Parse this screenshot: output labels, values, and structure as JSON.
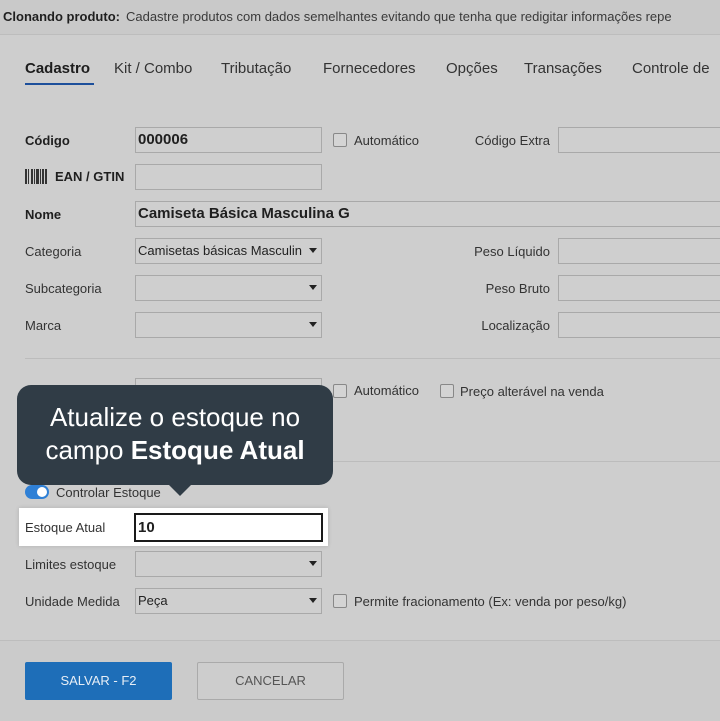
{
  "banner": {
    "title": "Clonando produto:",
    "message": "Cadastre produtos com dados semelhantes evitando que tenha que redigitar informações repe"
  },
  "tabs": [
    "Cadastro",
    "Kit / Combo",
    "Tributação",
    "Fornecedores",
    "Opções",
    "Transações",
    "Controle de"
  ],
  "form": {
    "codigo_label": "Código",
    "codigo_value": "000006",
    "automatico_label": "Automático",
    "codigo_extra_label": "Código Extra",
    "codigo_extra_value": "",
    "ean_label": "EAN / GTIN",
    "ean_value": "",
    "nome_label": "Nome",
    "nome_value": "Camiseta Básica Masculina G",
    "categoria_label": "Categoria",
    "categoria_value": "Camisetas básicas Masculin",
    "peso_liquido_label": "Peso Líquido",
    "subcategoria_label": "Subcategoria",
    "subcategoria_value": "",
    "peso_bruto_label": "Peso Bruto",
    "marca_label": "Marca",
    "marca_value": "",
    "localizacao_label": "Localização",
    "automatico2_label": "Automático",
    "preco_alteravel_label": "Preço alterável na venda",
    "controlar_estoque_label": "Controlar Estoque",
    "controlar_estoque_on": true,
    "estoque_atual_label": "Estoque Atual",
    "estoque_atual_value": "10",
    "limites_label": "Limites estoque",
    "limites_value": "",
    "unidade_label": "Unidade Medida",
    "unidade_value": "Peça",
    "fracionamento_label": "Permite fracionamento (Ex: venda por peso/kg)"
  },
  "tooltip": {
    "line1": "Atualize o estoque no",
    "line2_prefix": "campo ",
    "line2_bold": "Estoque Atual"
  },
  "buttons": {
    "save": "SALVAR - F2",
    "cancel": "CANCELAR"
  },
  "colors": {
    "primary": "#1e6eb8",
    "tooltip_bg": "#303c46",
    "toggle_on": "#2f80d6",
    "overlay_bg": "#cecece"
  }
}
